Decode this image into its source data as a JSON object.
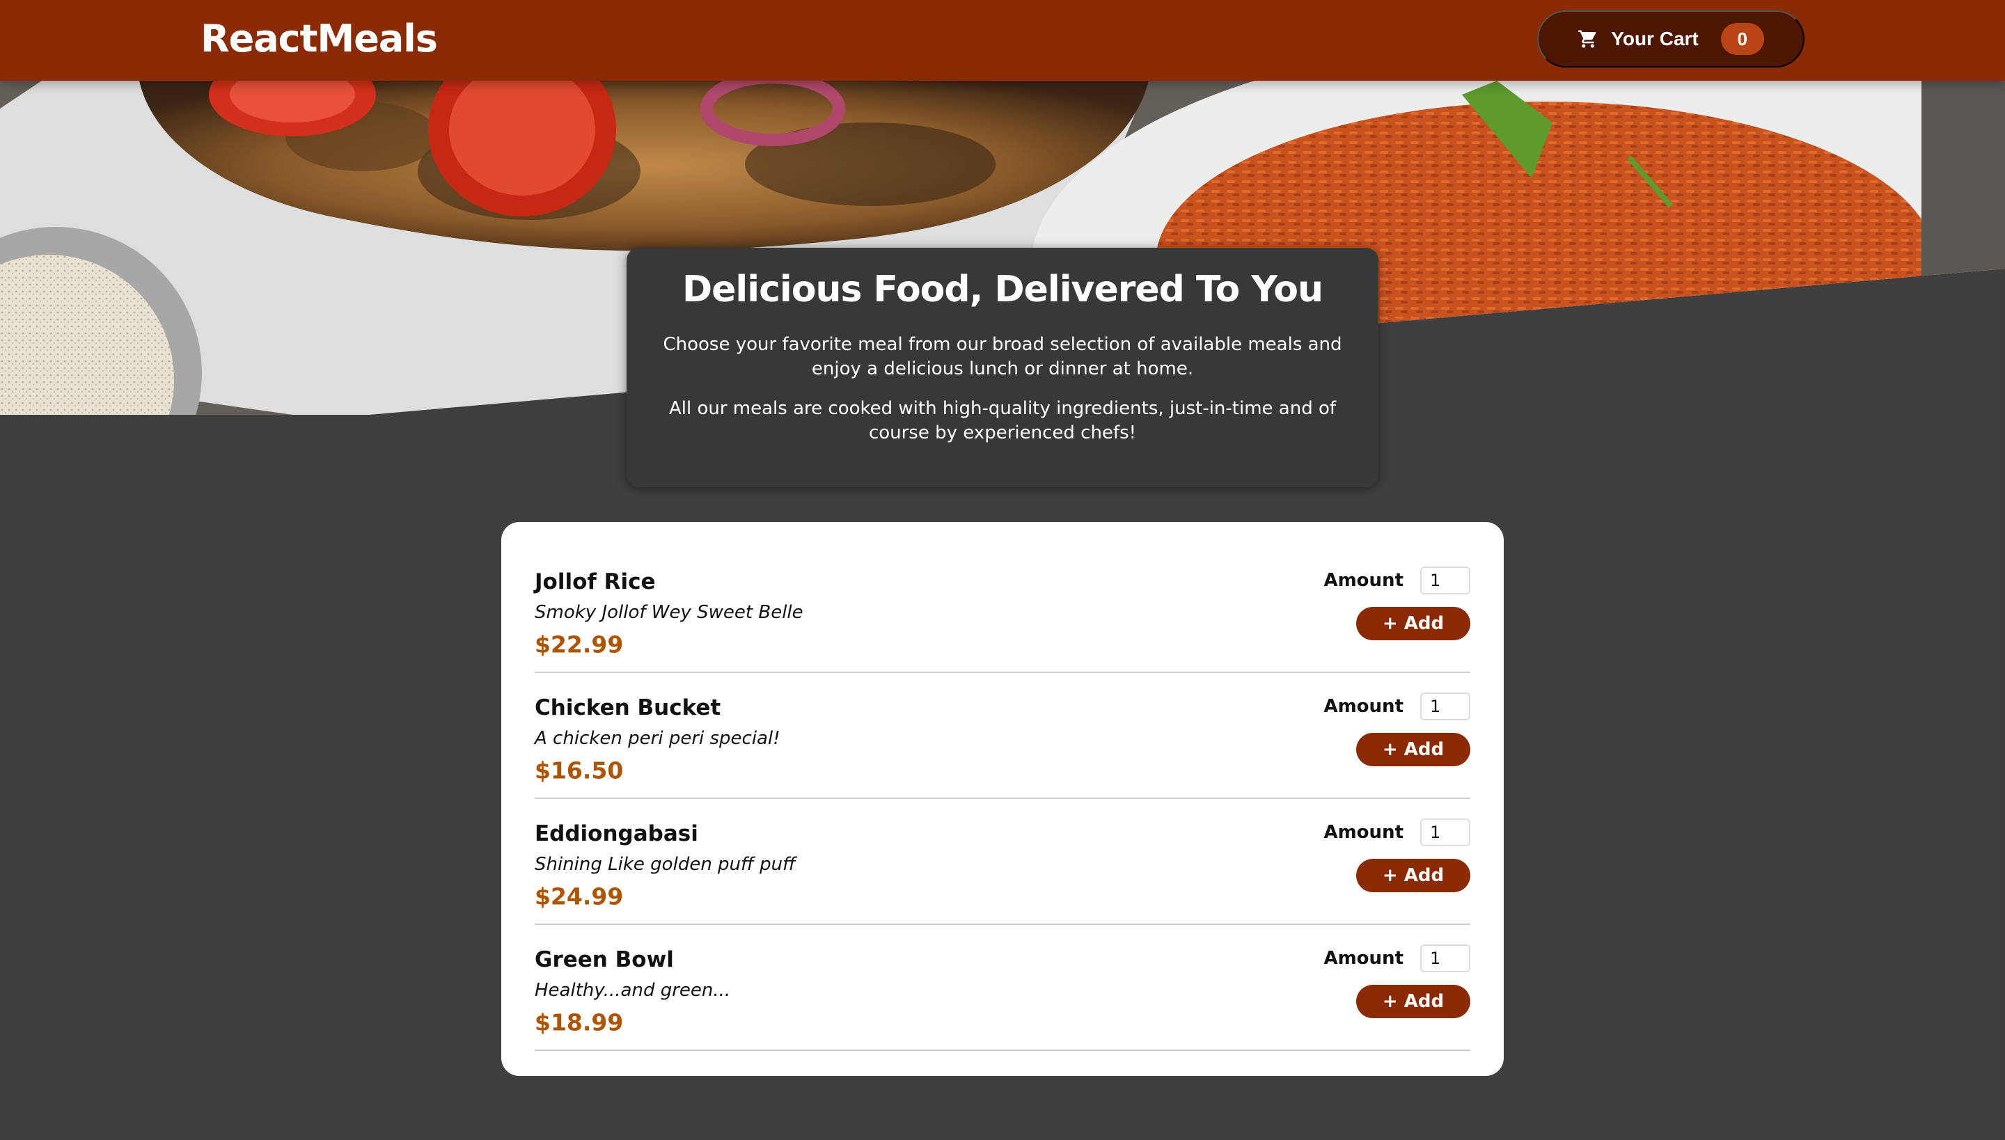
{
  "header": {
    "logo": "ReactMeals",
    "cart_label": "Your Cart",
    "cart_count": "0",
    "cart_icon": "cart-icon"
  },
  "hero": {
    "image": "meals-photo"
  },
  "summary": {
    "title": "Delicious Food, Delivered To You",
    "paragraph1": "Choose your favorite meal from our broad selection of available meals and enjoy a delicious lunch or dinner at home.",
    "paragraph2": "All our meals are cooked with high-quality ingredients, just-in-time and of course by experienced chefs!"
  },
  "meals": [
    {
      "name": "Jollof Rice",
      "description": "Smoky Jollof Wey Sweet Belle",
      "price": "$22.99",
      "amount_label": "Amount",
      "amount_value": "1",
      "add_label": "+ Add"
    },
    {
      "name": "Chicken Bucket",
      "description": "A chicken peri peri special!",
      "price": "$16.50",
      "amount_label": "Amount",
      "amount_value": "1",
      "add_label": "+ Add"
    },
    {
      "name": "Eddiongabasi",
      "description": "Shining Like golden puff puff",
      "price": "$24.99",
      "amount_label": "Amount",
      "amount_value": "1",
      "add_label": "+ Add"
    },
    {
      "name": "Green Bowl",
      "description": "Healthy...and green...",
      "price": "$18.99",
      "amount_label": "Amount",
      "amount_value": "1",
      "add_label": "+ Add"
    }
  ],
  "colors": {
    "header_bg": "#8a2b06",
    "cart_bg": "#4d1601",
    "badge_bg": "#b94517",
    "page_bg": "#3f3f3f",
    "price": "#ad5502"
  }
}
